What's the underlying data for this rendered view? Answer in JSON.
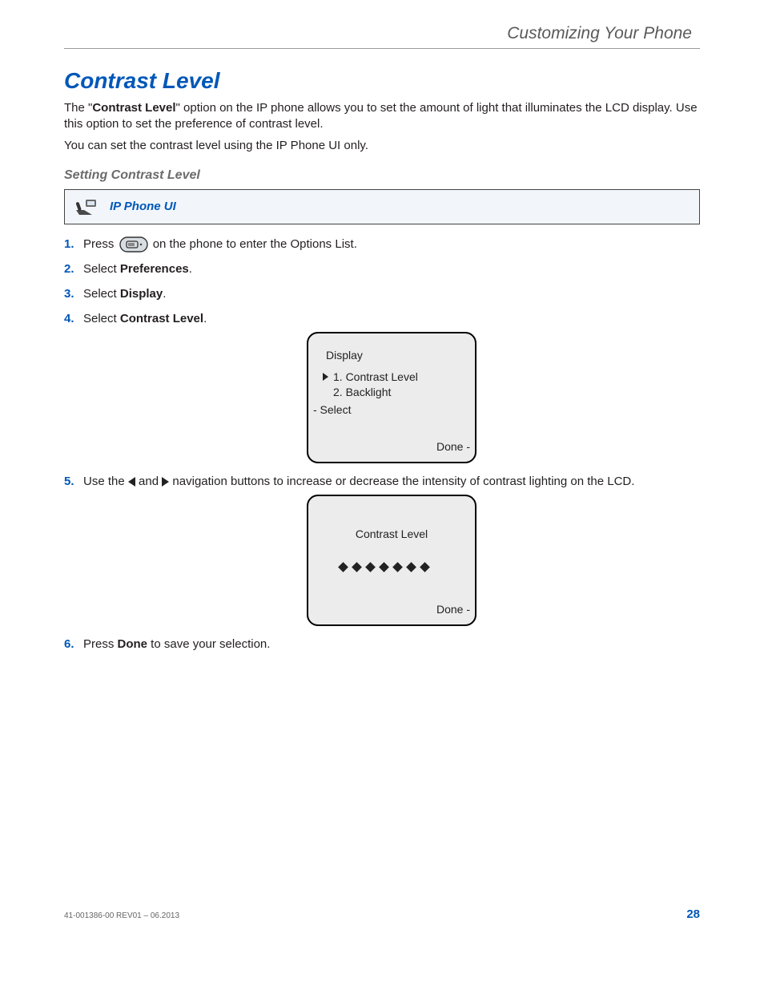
{
  "running_head": "Customizing Your Phone",
  "h1": "Contrast Level",
  "para1_a": "The \"",
  "para1_b": "Contrast Level",
  "para1_c": "\" option on the IP phone allows you to set the amount of light that illuminates the LCD display. Use this option to set the preference of contrast level.",
  "para2": "You can set the contrast level using the IP Phone UI only.",
  "h2": "Setting Contrast Level",
  "ui_label": "IP Phone UI",
  "steps": {
    "s1a": "Press ",
    "s1b": " on the phone to enter the Options List.",
    "s2a": "Select ",
    "s2b": "Preferences",
    "s2c": ".",
    "s3a": "Select ",
    "s3b": "Display",
    "s3c": ".",
    "s4a": "Select ",
    "s4b": "Contrast Level",
    "s4c": ".",
    "s5a": "Use the ",
    "s5b": " and ",
    "s5c": " navigation buttons to increase or decrease the intensity of contrast lighting on the LCD.",
    "s6a": "Press ",
    "s6b": "Done",
    "s6c": " to save your selection."
  },
  "lcd1": {
    "title": "Display",
    "item1": "1. Contrast Level",
    "item2": "2. Backlight",
    "select": "- Select",
    "done": "Done -"
  },
  "lcd2": {
    "title": "Contrast Level",
    "done": "Done -"
  },
  "footer_rev": "41-001386-00 REV01 – 06.2013",
  "page_number": "28"
}
